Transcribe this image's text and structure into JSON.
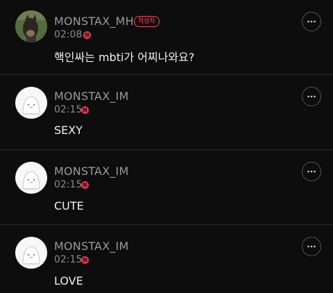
{
  "comments": [
    {
      "author": "MONSTAX_MH",
      "author_badge": "작성자",
      "time": "02:08",
      "new_marker": "N",
      "text": "핵인싸는 mbti가 어찌나와요?",
      "avatar": "photo-avatar"
    },
    {
      "author": "MONSTAX_IM",
      "time": "02:15",
      "new_marker": "N",
      "text": "SEXY",
      "avatar": "ghost-avatar"
    },
    {
      "author": "MONSTAX_IM",
      "time": "02:15",
      "new_marker": "N",
      "text": "CUTE",
      "avatar": "ghost-avatar"
    },
    {
      "author": "MONSTAX_IM",
      "time": "02:15",
      "new_marker": "N",
      "text": "LOVE",
      "avatar": "ghost-avatar"
    }
  ],
  "icons": {
    "more": "more-options-icon",
    "new": "new-badge"
  },
  "colors": {
    "background": "#0d0d0d",
    "accent_red": "#e8334a",
    "muted_text": "#9a9a9a",
    "divider": "#262626"
  }
}
